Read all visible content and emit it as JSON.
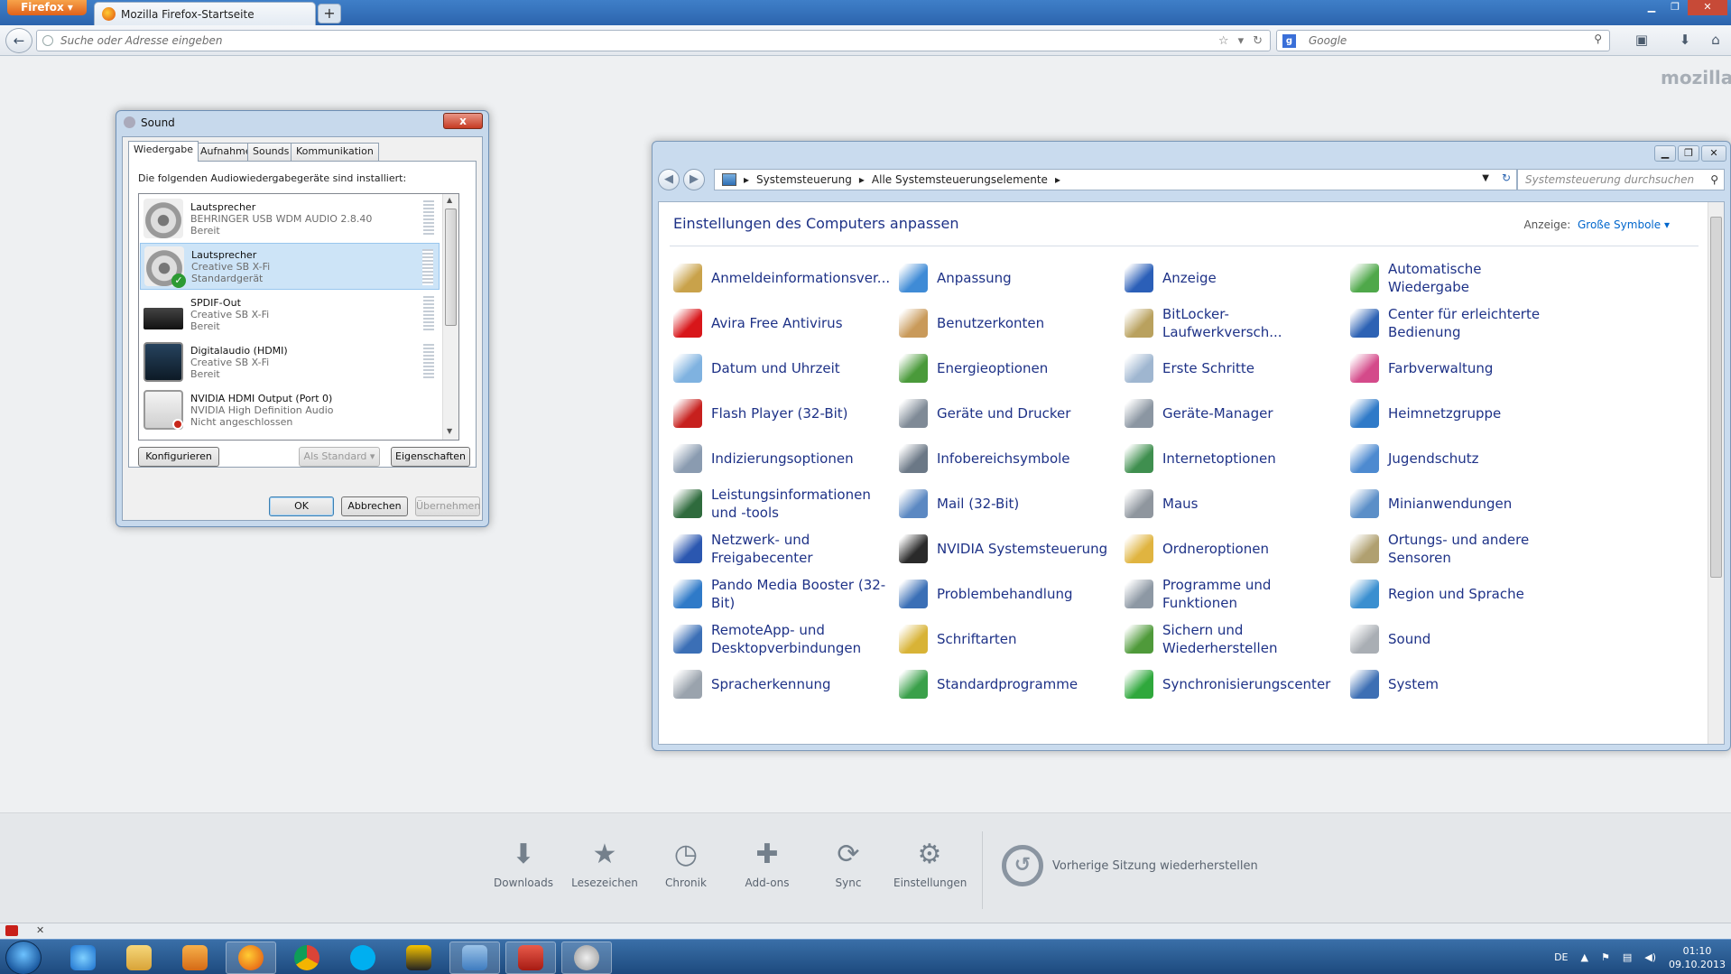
{
  "browser": {
    "menu_label": "Firefox",
    "tab_title": "Mozilla Firefox-Startseite",
    "new_tab": "+",
    "url_placeholder": "Suche oder Adresse eingeben",
    "search_placeholder": "Google",
    "brand": "mozilla"
  },
  "sound": {
    "title": "Sound",
    "close": "x",
    "tabs": [
      "Wiedergabe",
      "Aufnahme",
      "Sounds",
      "Kommunikation"
    ],
    "intro": "Die folgenden Audiowiedergabegeräte sind installiert:",
    "devices": [
      {
        "name": "Lautsprecher",
        "desc": "BEHRINGER USB WDM AUDIO 2.8.40",
        "status": "Bereit"
      },
      {
        "name": "Lautsprecher",
        "desc": "Creative SB X-Fi",
        "status": "Standardgerät"
      },
      {
        "name": "SPDIF-Out",
        "desc": "Creative SB X-Fi",
        "status": "Bereit"
      },
      {
        "name": "Digitalaudio (HDMI)",
        "desc": "Creative SB X-Fi",
        "status": "Bereit"
      },
      {
        "name": "NVIDIA HDMI Output (Port 0)",
        "desc": "NVIDIA High Definition Audio",
        "status": "Nicht angeschlossen"
      }
    ],
    "buttons": {
      "configure": "Konfigurieren",
      "set_default": "Als Standard",
      "properties": "Eigenschaften",
      "ok": "OK",
      "cancel": "Abbrechen",
      "apply": "Übernehmen"
    }
  },
  "control_panel": {
    "breadcrumb": [
      "Systemsteuerung",
      "Alle Systemsteuerungselemente"
    ],
    "search_placeholder": "Systemsteuerung durchsuchen",
    "heading": "Einstellungen des Computers anpassen",
    "view_label": "Anzeige:",
    "view_value": "Große Symbole",
    "columns": [
      [
        {
          "label": "Anmeldeinformationsver...",
          "color": "#c9a24a"
        },
        {
          "label": "Avira Free Antivirus",
          "color": "#d8161a"
        },
        {
          "label": "Datum und Uhrzeit",
          "color": "#7fb2e0"
        },
        {
          "label": "Flash Player (32-Bit)",
          "color": "#c7201e"
        },
        {
          "label": "Indizierungsoptionen",
          "color": "#8a9bb0"
        },
        {
          "label": "Leistungsinformationen und -tools",
          "color": "#2f6b3d"
        },
        {
          "label": "Netzwerk- und Freigabecenter",
          "color": "#2b57b0"
        },
        {
          "label": "Pando Media Booster (32-Bit)",
          "color": "#2f7ac8"
        },
        {
          "label": "RemoteApp- und Desktopverbindungen",
          "color": "#3b6fb6"
        },
        {
          "label": "Spracherkennung",
          "color": "#9aa3ad"
        }
      ],
      [
        {
          "label": "Anpassung",
          "color": "#3f8bd6"
        },
        {
          "label": "Benutzerkonten",
          "color": "#c99a5a"
        },
        {
          "label": "Energieoptionen",
          "color": "#4a9a3a"
        },
        {
          "label": "Geräte und Drucker",
          "color": "#7f8a96"
        },
        {
          "label": "Infobereichsymbole",
          "color": "#6b7886"
        },
        {
          "label": "Mail (32-Bit)",
          "color": "#5b88c2"
        },
        {
          "label": "NVIDIA Systemsteuerung",
          "color": "#2a2a2a"
        },
        {
          "label": "Problembehandlung",
          "color": "#3a6fb6"
        },
        {
          "label": "Schriftarten",
          "color": "#d8b336"
        },
        {
          "label": "Standardprogramme",
          "color": "#3aa04a"
        }
      ],
      [
        {
          "label": "Anzeige",
          "color": "#2b5fb8"
        },
        {
          "label": "BitLocker-Laufwerkversch...",
          "color": "#b9a15e"
        },
        {
          "label": "Erste Schritte",
          "color": "#9fb6d0"
        },
        {
          "label": "Geräte-Manager",
          "color": "#8b96a2"
        },
        {
          "label": "Internetoptionen",
          "color": "#3f8f4f"
        },
        {
          "label": "Maus",
          "color": "#8f969e"
        },
        {
          "label": "Ordneroptionen",
          "color": "#e0b440"
        },
        {
          "label": "Programme und Funktionen",
          "color": "#8d98a4"
        },
        {
          "label": "Sichern und Wiederherstellen",
          "color": "#4f9a3a"
        },
        {
          "label": "Synchronisierungscenter",
          "color": "#2fa83c"
        }
      ],
      [
        {
          "label": "Automatische Wiedergabe",
          "color": "#4fa84a"
        },
        {
          "label": "Center für erleichterte Bedienung",
          "color": "#2d62b4"
        },
        {
          "label": "Farbverwaltung",
          "color": "#d44a8a"
        },
        {
          "label": "Heimnetzgruppe",
          "color": "#2f7ac8"
        },
        {
          "label": "Jugendschutz",
          "color": "#4d8ad0"
        },
        {
          "label": "Minianwendungen",
          "color": "#5b8fc8"
        },
        {
          "label": "Ortungs- und andere Sensoren",
          "color": "#b0a070"
        },
        {
          "label": "Region und Sprache",
          "color": "#3a8fd0"
        },
        {
          "label": "Sound",
          "color": "#a9aeb4"
        },
        {
          "label": "System",
          "color": "#3d6fb4"
        }
      ]
    ]
  },
  "newtab_bar": {
    "items": [
      "Downloads",
      "Lesezeichen",
      "Chronik",
      "Add-ons",
      "Sync",
      "Einstellungen"
    ],
    "restore": "Vorherige Sitzung wiederherstellen"
  },
  "taskbar": {
    "lang": "DE",
    "time": "01:10",
    "date": "09.10.2013"
  }
}
